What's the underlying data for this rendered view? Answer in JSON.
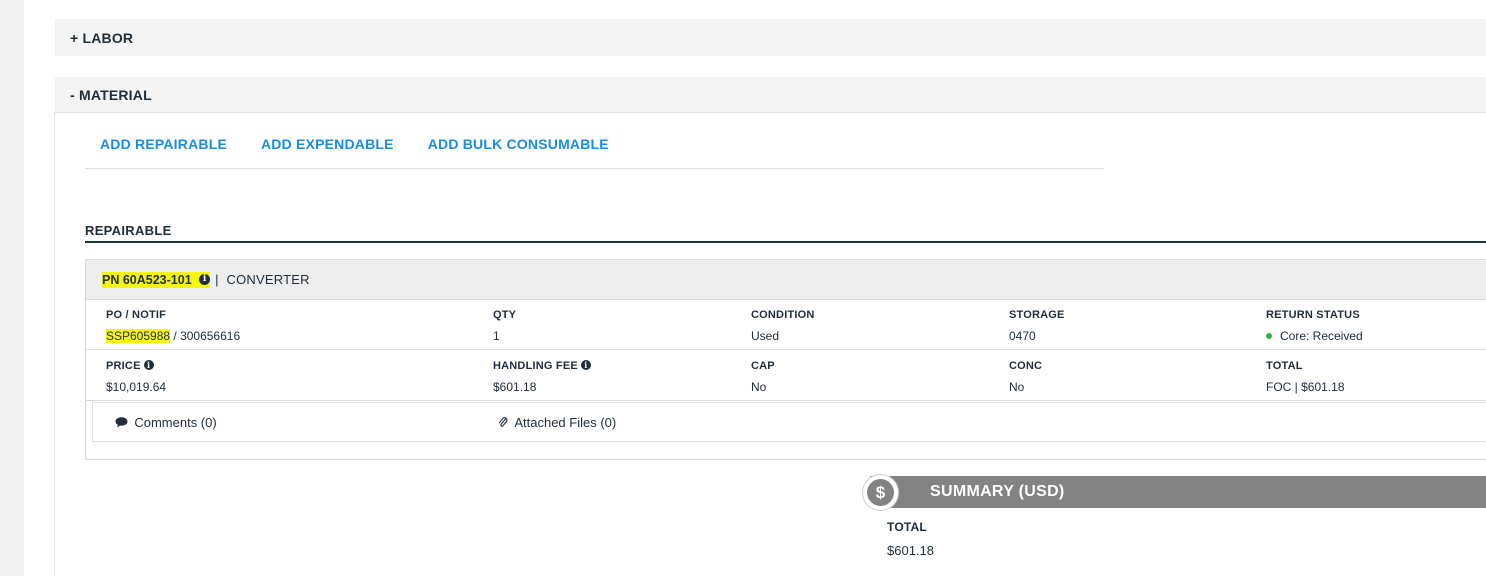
{
  "sections": {
    "labor_label": "+ LABOR",
    "material_label": "- MATERIAL"
  },
  "add_actions": {
    "repairable": "ADD REPAIRABLE",
    "expendable": "ADD EXPENDABLE",
    "bulk_consumable": "ADD BULK CONSUMABLE"
  },
  "repairable": {
    "title": "REPAIRABLE",
    "part_number": "PN 60A523-101",
    "separator": "|",
    "description": "CONVERTER",
    "fields_row1": {
      "po_label": "PO / NOTIF",
      "po_value": "SSP605988",
      "notif_value": " / 300656616",
      "qty_label": "QTY",
      "qty_value": "1",
      "condition_label": "CONDITION",
      "condition_value": "Used",
      "storage_label": "STORAGE",
      "storage_value": "0470",
      "return_status_label": "RETURN STATUS",
      "return_status_value": "Core: Received",
      "return_status_color": "#2fb44a"
    },
    "fields_row2": {
      "price_label": "PRICE",
      "price_value": "$10,019.64",
      "handling_fee_label": "HANDLING FEE",
      "handling_fee_value": "$601.18",
      "cap_label": "CAP",
      "cap_value": "No",
      "conc_label": "CONC",
      "conc_value": "No",
      "total_label": "TOTAL",
      "total_value": "FOC | $601.18"
    },
    "comments_label": "Comments (0)",
    "attached_files_label": "Attached Files (0)"
  },
  "summary": {
    "title": "SUMMARY (USD)",
    "currency_symbol": "$",
    "total_label": "TOTAL",
    "total_value": "$601.18"
  },
  "colors": {
    "link_blue": "#1a8ce0",
    "highlight_yellow": "#f5f50e",
    "summary_gray": "#838383",
    "dark_text": "#1f2d3d"
  }
}
